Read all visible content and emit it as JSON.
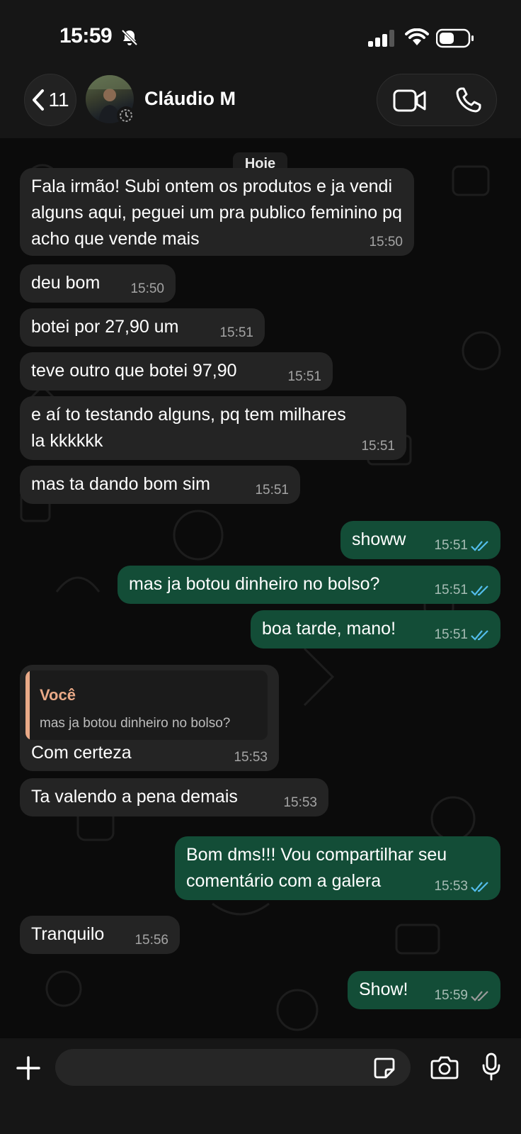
{
  "status_bar": {
    "time": "15:59"
  },
  "header": {
    "back_count": "11",
    "contact_name": "Cláudio M"
  },
  "chat": {
    "date_label": "Hoje",
    "messages": [
      {
        "dir": "in",
        "text": "Fala irmão! Subi ontem os produtos e ja vendi alguns aqui, peguei um pra publico feminino pq acho que vende mais",
        "time": "15:50"
      },
      {
        "dir": "in",
        "text": "deu bom",
        "time": "15:50"
      },
      {
        "dir": "in",
        "text": "botei por 27,90 um",
        "time": "15:51"
      },
      {
        "dir": "in",
        "text": "teve outro que botei 97,90",
        "time": "15:51"
      },
      {
        "dir": "in",
        "text": "e aí to testando alguns, pq tem milhares la kkkkkk",
        "time": "15:51"
      },
      {
        "dir": "in",
        "text": "mas ta dando bom sim",
        "time": "15:51"
      },
      {
        "dir": "out",
        "text": "showw",
        "time": "15:51",
        "status": "read"
      },
      {
        "dir": "out",
        "text": "mas ja botou dinheiro no bolso?",
        "time": "15:51",
        "status": "read"
      },
      {
        "dir": "out",
        "text": "boa tarde, mano!",
        "time": "15:51",
        "status": "read"
      },
      {
        "dir": "in",
        "text": "Com certeza",
        "time": "15:53",
        "reply_to": {
          "author": "Você",
          "text": "mas ja botou dinheiro no bolso?"
        }
      },
      {
        "dir": "in",
        "text": "Ta valendo a pena demais",
        "time": "15:53"
      },
      {
        "dir": "out",
        "text": "Bom dms!!! Vou compartilhar seu comentário com a galera",
        "time": "15:53",
        "status": "read"
      },
      {
        "dir": "in",
        "text": "Tranquilo",
        "time": "15:56"
      },
      {
        "dir": "out",
        "text": "Show!",
        "time": "15:59",
        "status": "delivered"
      }
    ]
  },
  "input": {
    "placeholder": ""
  },
  "colors": {
    "incoming_bubble": "#242424",
    "outgoing_bubble": "#134d37",
    "read_ticks": "#53bdeb",
    "delivered_ticks": "#9a9a9a",
    "quote_accent": "#e9a987"
  },
  "icons": [
    "bell-off-icon",
    "signal-icon",
    "wifi-icon",
    "battery-icon",
    "back-chevron-icon",
    "video-call-icon",
    "phone-icon",
    "plus-icon",
    "sticker-icon",
    "camera-icon",
    "mic-icon",
    "double-check-icon"
  ]
}
